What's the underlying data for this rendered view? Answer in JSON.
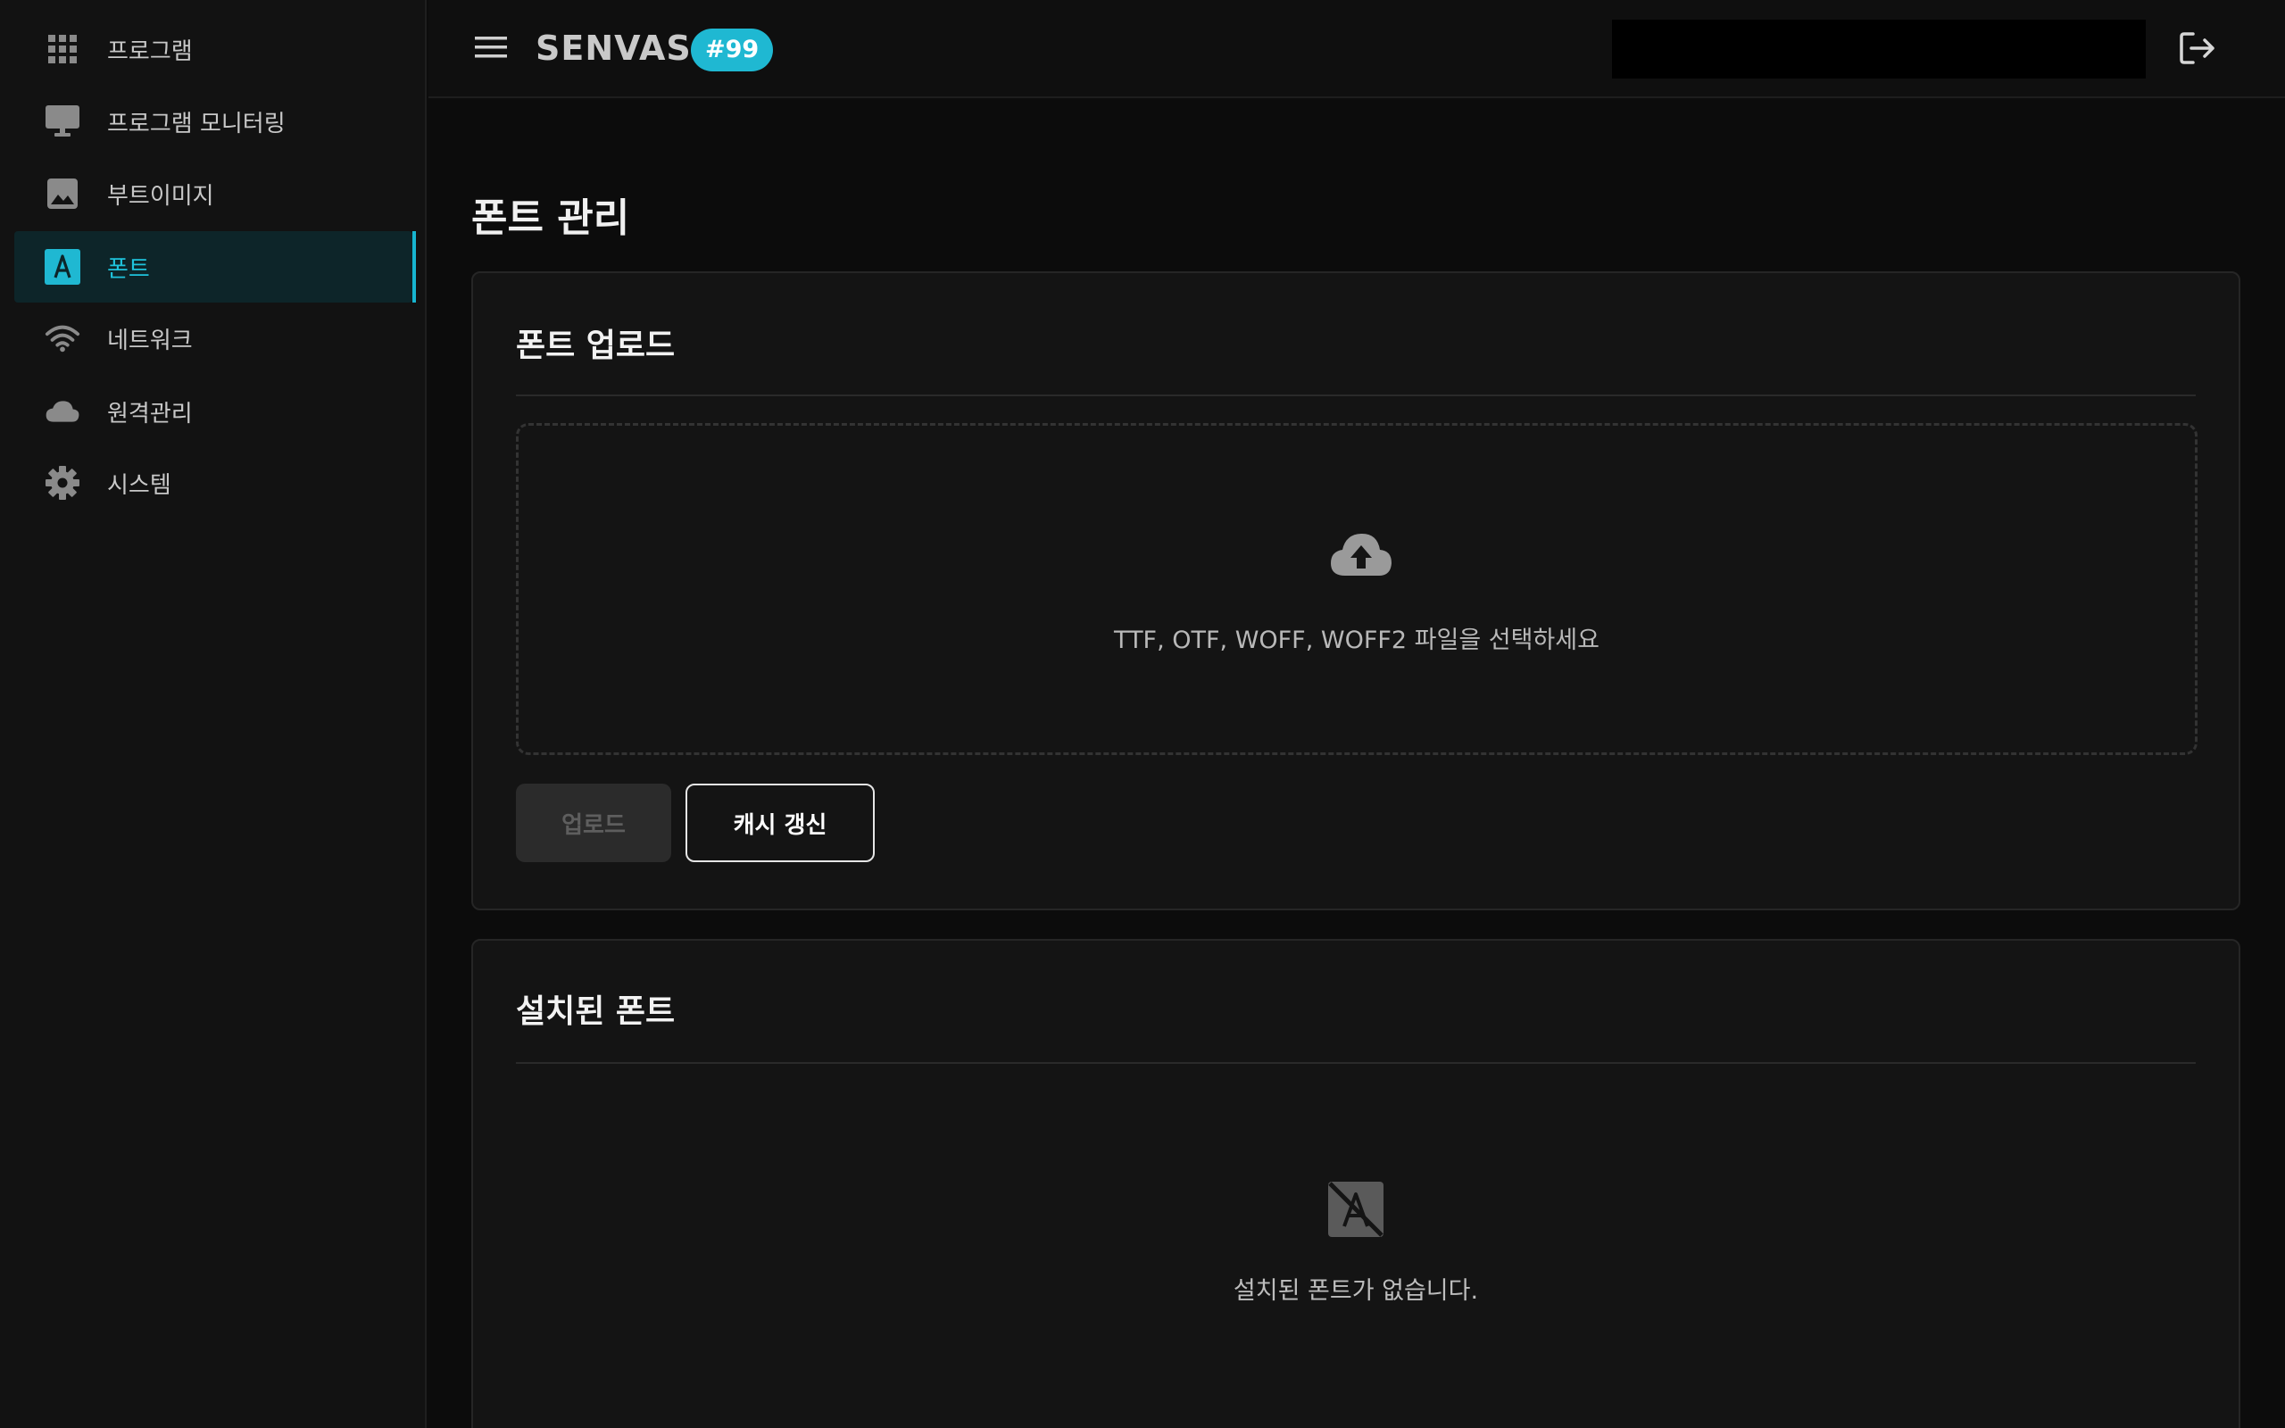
{
  "app": {
    "brand": "SENVAS",
    "badge": "#99"
  },
  "sidebar": {
    "items": [
      {
        "label": "프로그램",
        "icon": "grid-icon"
      },
      {
        "label": "프로그램 모니터링",
        "icon": "monitor-icon"
      },
      {
        "label": "부트이미지",
        "icon": "image-icon"
      },
      {
        "label": "폰트",
        "icon": "font-icon",
        "active": true
      },
      {
        "label": "네트워크",
        "icon": "wifi-icon"
      },
      {
        "label": "원격관리",
        "icon": "cloud-icon"
      },
      {
        "label": "시스템",
        "icon": "gear-icon"
      }
    ]
  },
  "page": {
    "title": "폰트 관리"
  },
  "upload_card": {
    "title": "폰트 업로드",
    "dropzone_text": "TTF, OTF, WOFF, WOFF2 파일을 선택하세요",
    "upload_label": "업로드",
    "cache_label": "캐시 갱신"
  },
  "installed_card": {
    "title": "설치된 폰트",
    "empty_text": "설치된 폰트가 없습니다."
  },
  "colors": {
    "accent": "#1fb8d2",
    "background": "#0c0c0c",
    "sidebar": "#121212",
    "card": "#141414"
  }
}
